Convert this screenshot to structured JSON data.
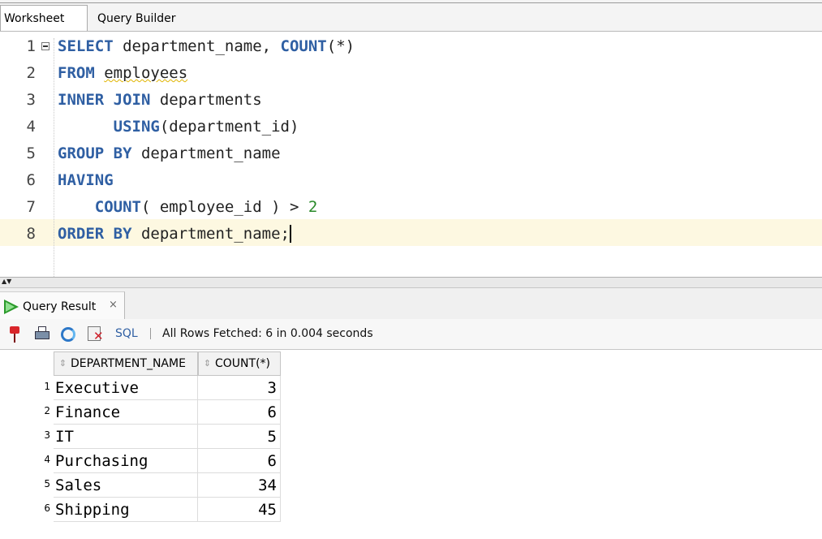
{
  "tabs": {
    "worksheet": "Worksheet",
    "query_builder": "Query Builder"
  },
  "editor": {
    "lines": [
      {
        "n": "1",
        "tokens": [
          {
            "t": "SELECT",
            "k": "kw"
          },
          {
            "t": " department_name, ",
            "k": "id"
          },
          {
            "t": "COUNT",
            "k": "kw"
          },
          {
            "t": "(*)",
            "k": "id"
          }
        ]
      },
      {
        "n": "2",
        "tokens": [
          {
            "t": "FROM",
            "k": "kw"
          },
          {
            "t": " ",
            "k": "id"
          },
          {
            "t": "employees",
            "k": "squig"
          }
        ]
      },
      {
        "n": "3",
        "tokens": [
          {
            "t": "INNER JOIN",
            "k": "kw"
          },
          {
            "t": " departments",
            "k": "id"
          }
        ]
      },
      {
        "n": "4",
        "tokens": [
          {
            "t": "      ",
            "k": "id"
          },
          {
            "t": "USING",
            "k": "kw"
          },
          {
            "t": "(department_id)",
            "k": "id"
          }
        ]
      },
      {
        "n": "5",
        "tokens": [
          {
            "t": "GROUP BY",
            "k": "kw"
          },
          {
            "t": " department_name",
            "k": "id"
          }
        ]
      },
      {
        "n": "6",
        "tokens": [
          {
            "t": "HAVING",
            "k": "kw"
          }
        ]
      },
      {
        "n": "7",
        "tokens": [
          {
            "t": "    ",
            "k": "id"
          },
          {
            "t": "COUNT",
            "k": "kw"
          },
          {
            "t": "( employee_id ) > ",
            "k": "id"
          },
          {
            "t": "2",
            "k": "num"
          }
        ]
      },
      {
        "n": "8",
        "tokens": [
          {
            "t": "ORDER BY",
            "k": "kw"
          },
          {
            "t": " department_name;",
            "k": "id"
          }
        ],
        "current": true
      }
    ]
  },
  "result": {
    "tab_label": "Query Result",
    "close": "×",
    "sql_label": "SQL",
    "status": "All Rows Fetched: 6 in 0.004 seconds",
    "columns": [
      "DEPARTMENT_NAME",
      "COUNT(*)"
    ],
    "rows": [
      {
        "n": "1",
        "dept": "Executive",
        "count": "3"
      },
      {
        "n": "2",
        "dept": "Finance",
        "count": "6"
      },
      {
        "n": "3",
        "dept": "IT",
        "count": "5"
      },
      {
        "n": "4",
        "dept": "Purchasing",
        "count": "6"
      },
      {
        "n": "5",
        "dept": "Sales",
        "count": "34"
      },
      {
        "n": "6",
        "dept": "Shipping",
        "count": "45"
      }
    ]
  },
  "icons": {
    "pin": "pin-icon",
    "print": "print-icon",
    "refresh": "refresh-icon",
    "cancel": "cancel-icon",
    "run": "run-icon",
    "sort": "sort-icon",
    "fold": "fold-icon",
    "splitter": "splitter-arrows-icon"
  },
  "colors": {
    "keyword": "#2f5fa3",
    "number": "#2a8a2a",
    "current_line": "#fdf8e1",
    "run_icon": "#2b9a2b"
  }
}
